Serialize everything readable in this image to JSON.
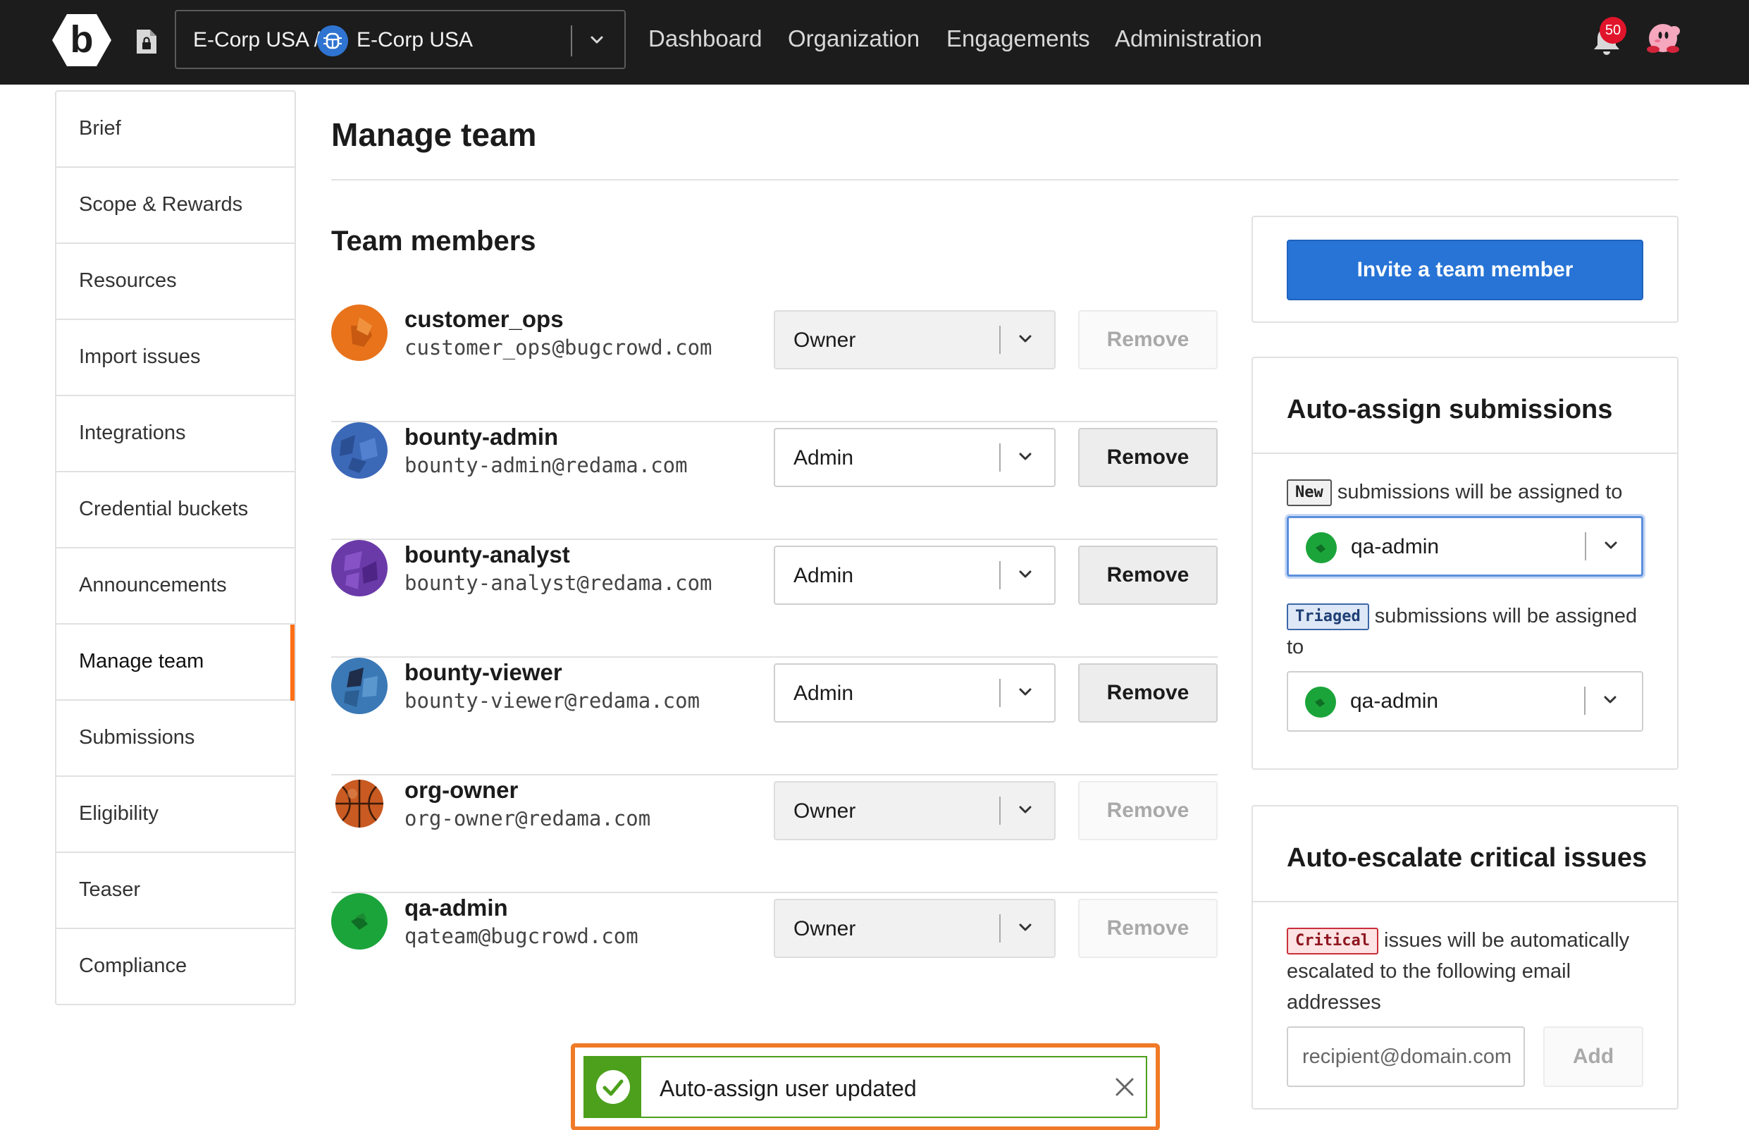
{
  "header": {
    "org_prefix": "E-Corp USA /",
    "org_name": "E-Corp USA",
    "nav": [
      "Dashboard",
      "Organization",
      "Engagements",
      "Administration"
    ],
    "notification_count": "50"
  },
  "sidebar": {
    "items": [
      {
        "label": "Brief"
      },
      {
        "label": "Scope & Rewards"
      },
      {
        "label": "Resources"
      },
      {
        "label": "Import issues"
      },
      {
        "label": "Integrations"
      },
      {
        "label": "Credential buckets"
      },
      {
        "label": "Announcements"
      },
      {
        "label": "Manage team"
      },
      {
        "label": "Submissions"
      },
      {
        "label": "Eligibility"
      },
      {
        "label": "Teaser"
      },
      {
        "label": "Compliance"
      }
    ],
    "active": "Manage team"
  },
  "main": {
    "title": "Manage team",
    "section_title": "Team members",
    "remove_label": "Remove",
    "members": [
      {
        "username": "customer_ops",
        "email": "customer_ops@bugcrowd.com",
        "role": "Owner",
        "editable": false,
        "avatar_color": "#e8731b"
      },
      {
        "username": "bounty-admin",
        "email": "bounty-admin@redama.com",
        "role": "Admin",
        "editable": true,
        "avatar_color": "#3c68b8"
      },
      {
        "username": "bounty-analyst",
        "email": "bounty-analyst@redama.com",
        "role": "Admin",
        "editable": true,
        "avatar_color": "#6a3aa8"
      },
      {
        "username": "bounty-viewer",
        "email": "bounty-viewer@redama.com",
        "role": "Admin",
        "editable": true,
        "avatar_color": "#3a79b6"
      },
      {
        "username": "org-owner",
        "email": "org-owner@redama.com",
        "role": "Owner",
        "editable": false,
        "avatar_color": "#c85a22"
      },
      {
        "username": "qa-admin",
        "email": "qateam@bugcrowd.com",
        "role": "Owner",
        "editable": false,
        "avatar_color": "#1ba43a"
      }
    ]
  },
  "invite": {
    "label": "Invite a team member"
  },
  "auto_assign": {
    "title": "Auto-assign submissions",
    "new_tag": "New",
    "new_text": "submissions will be assigned to",
    "new_user": "qa-admin",
    "triaged_tag": "Triaged",
    "triaged_text": "submissions will be assigned to",
    "triaged_user": "qa-admin"
  },
  "auto_escalate": {
    "title": "Auto-escalate critical issues",
    "critical_tag": "Critical",
    "text": "issues will be automatically escalated to the following email addresses",
    "placeholder": "recipient@domain.com",
    "add_label": "Add"
  },
  "toast": {
    "message": "Auto-assign user updated"
  },
  "colors": {
    "accent": "#ff6f16",
    "primary": "#2774d6",
    "success": "#4ca01c",
    "topbar": "#1c1c1c"
  }
}
